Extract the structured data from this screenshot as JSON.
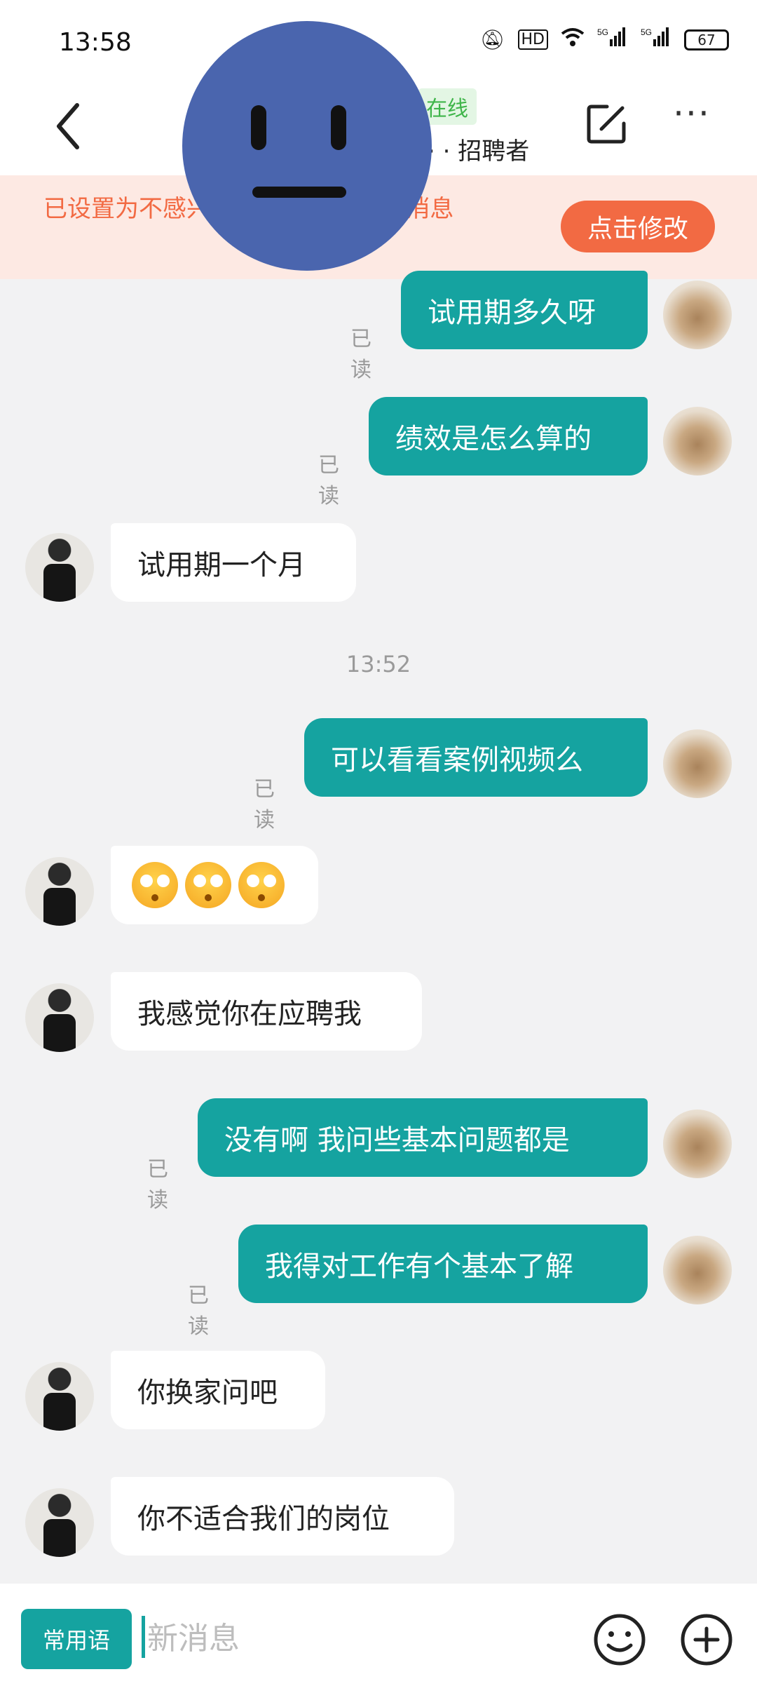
{
  "status_bar": {
    "time": "13:58",
    "icons": [
      "mute-icon",
      "hd-icon",
      "wifi-icon",
      "signal-5g-icon",
      "signal-5g-icon"
    ],
    "battery": "67"
  },
  "header": {
    "online_badge": "在线",
    "role_text": "· · 招聘者"
  },
  "banner": {
    "text": "已设置为不感兴趣，不再提示TA的消息",
    "button": "点击修改"
  },
  "read_label": "已读",
  "messages": [
    {
      "side": "out",
      "text": "试用期多久呀",
      "read": "已读"
    },
    {
      "side": "out",
      "text": "绩效是怎么算的",
      "read": "已读"
    },
    {
      "side": "in",
      "text": "试用期一个月"
    },
    {
      "side": "time",
      "text": "13:52"
    },
    {
      "side": "out",
      "text": "可以看看案例视频么",
      "read": "已读"
    },
    {
      "side": "in",
      "text": "",
      "emoji": [
        "flushed-face",
        "flushed-face",
        "flushed-face"
      ]
    },
    {
      "side": "in",
      "text": "我感觉你在应聘我"
    },
    {
      "side": "out",
      "text": "没有啊 我问些基本问题都是",
      "read": "已读"
    },
    {
      "side": "out",
      "text": "我得对工作有个基本了解",
      "read": "已读"
    },
    {
      "side": "in",
      "text": "你换家问吧"
    },
    {
      "side": "in",
      "text": "你不适合我们的岗位"
    }
  ],
  "input_bar": {
    "phrases_button": "常用语",
    "placeholder": "新消息"
  },
  "colors": {
    "accent": "#15a3a0",
    "banner_bg": "#fde9e3",
    "banner_text": "#f26a43",
    "online": "#3fb54a"
  }
}
